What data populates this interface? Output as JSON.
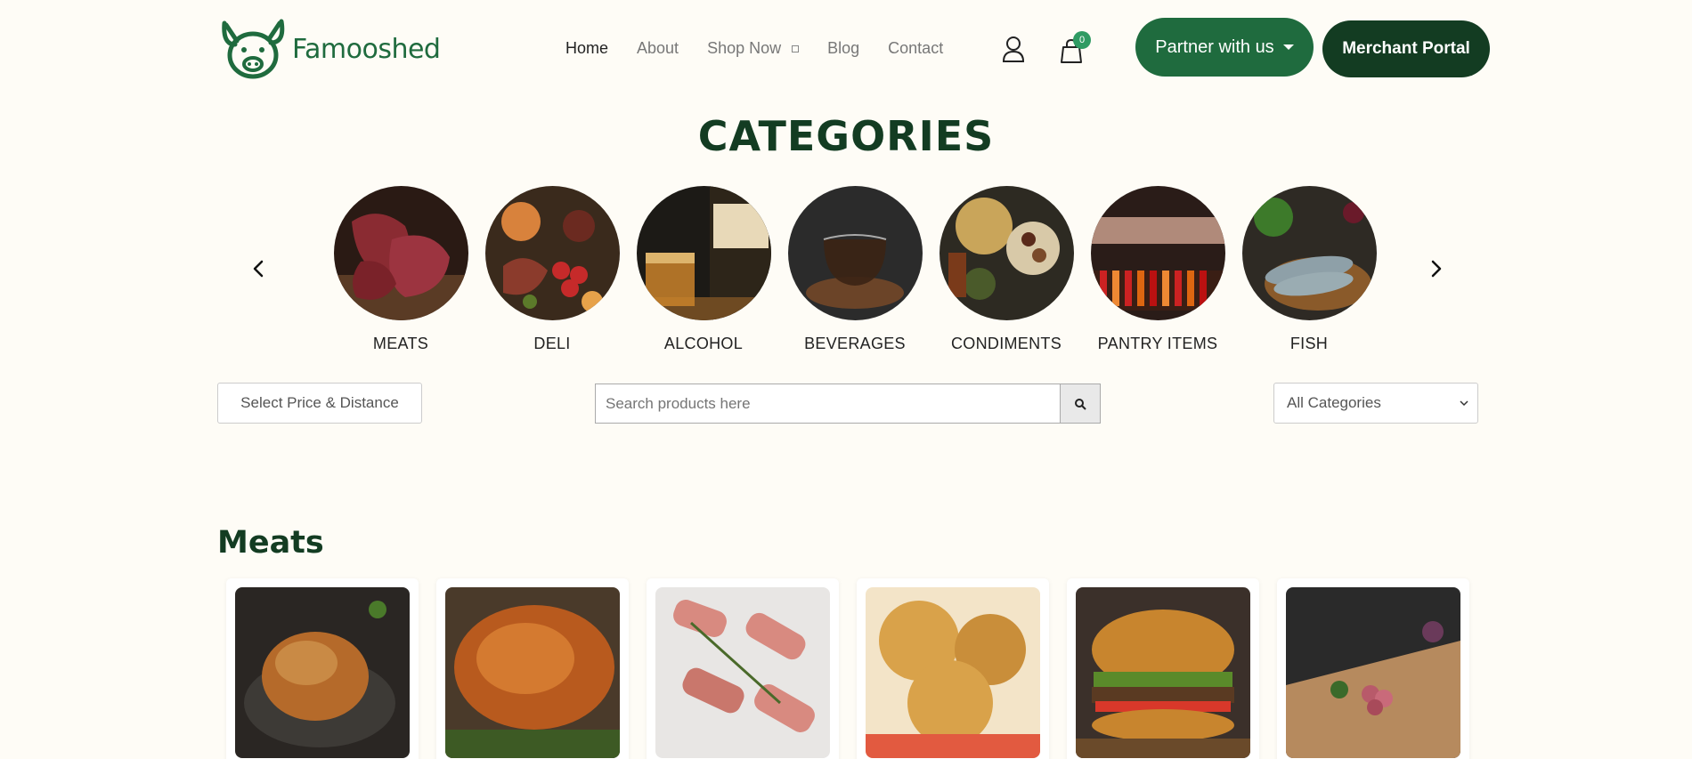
{
  "brand": {
    "name": "Famooshed",
    "color": "#1f6b3e"
  },
  "nav": {
    "home": "Home",
    "about": "About",
    "shop_now": "Shop Now",
    "blog": "Blog",
    "contact": "Contact"
  },
  "cart": {
    "count": "0"
  },
  "buttons": {
    "partner": "Partner with us",
    "merchant": "Merchant Portal"
  },
  "categories_section": {
    "title": "CATEGORIES",
    "items": [
      {
        "label": "MEATS"
      },
      {
        "label": "DELI"
      },
      {
        "label": "ALCOHOL"
      },
      {
        "label": "BEVERAGES"
      },
      {
        "label": "CONDIMENTS"
      },
      {
        "label": "PANTRY ITEMS"
      },
      {
        "label": "FISH"
      }
    ]
  },
  "filters": {
    "price_distance": "Select Price & Distance",
    "search_placeholder": "Search products here",
    "category_selected": "All Categories"
  },
  "meats_section": {
    "title": "Meats"
  },
  "colors": {
    "primary_green": "#1f6b3e",
    "dark_green": "#133c22",
    "badge_green": "#2f9b63",
    "background": "#fefcf6"
  }
}
